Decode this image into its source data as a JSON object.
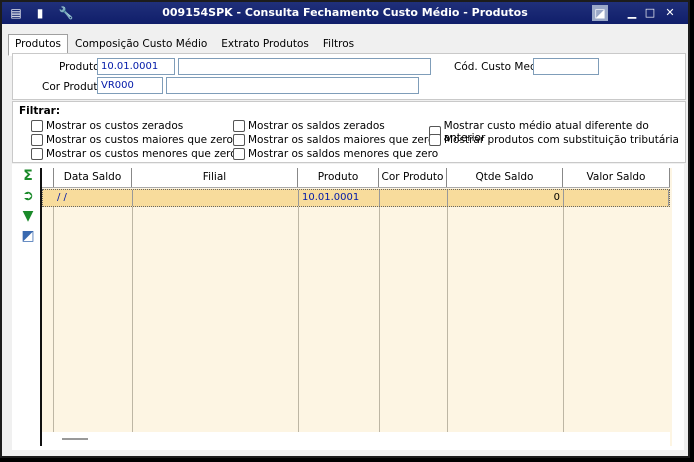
{
  "window": {
    "title": "009154SPK - Consulta Fechamento Custo Médio - Produtos",
    "minimize": "▁",
    "maximize": "□",
    "close": "✕"
  },
  "tabs": [
    {
      "label": "Produtos",
      "active": true
    },
    {
      "label": "Composição Custo Médio"
    },
    {
      "label": "Extrato Produtos"
    },
    {
      "label": "Filtros"
    }
  ],
  "form": {
    "produto_label": "Produto",
    "produto_value": "10.01.0001",
    "produto_desc": "",
    "cor_label": "Cor Produto",
    "cor_value": "VR000",
    "cor_desc": "",
    "cod_custo_label": "Cód. Custo Medio",
    "cod_custo_value": ""
  },
  "filters": {
    "title": "Filtrar:",
    "options": [
      "Mostrar os custos zerados",
      "Mostrar os custos maiores que zero",
      "Mostrar os custos menores que zero",
      "Mostrar os saldos zerados",
      "Mostrar os saldos maiores que zero",
      "Mostrar os saldos menores que zero",
      "Mostrar custo médio atual diferente do anterior",
      "Mostrar produtos com substituição tributária"
    ]
  },
  "side_icons": [
    "sum-icon",
    "export-icon",
    "filter-down-icon",
    "image-icon"
  ],
  "grid": {
    "columns": [
      "Data Saldo",
      "Filial",
      "Produto",
      "Cor Produto",
      "Qtde Saldo",
      "Valor Saldo"
    ],
    "rows": [
      [
        "/ /",
        "",
        "10.01.0001",
        "",
        "0",
        ""
      ]
    ]
  }
}
